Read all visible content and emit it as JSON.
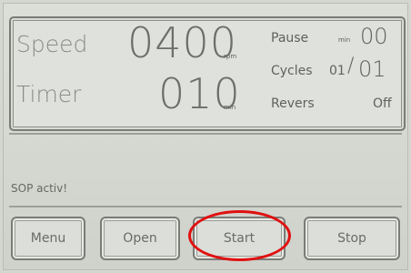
{
  "display": {
    "speed_label": "Speed",
    "speed_value": "0400",
    "speed_unit": "rpm",
    "timer_label": "Timer",
    "timer_value": "010",
    "timer_unit": "min",
    "pause_label": "Pause",
    "pause_unit": "min",
    "pause_value": "00",
    "cycles_label": "Cycles",
    "cycles_current": "01",
    "cycles_sep": "/",
    "cycles_total": "01",
    "revers_label": "Revers",
    "revers_value": "Off"
  },
  "status_text": "SOP activ!",
  "buttons": {
    "menu": "Menu",
    "open": "Open",
    "start": "Start",
    "stop": "Stop"
  },
  "colors": {
    "highlight_circle": "#e01010"
  }
}
